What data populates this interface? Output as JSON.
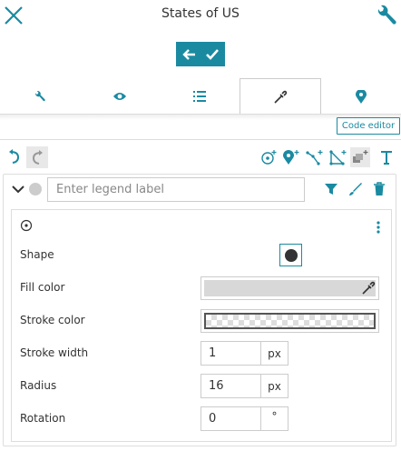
{
  "header": {
    "title": "States of US"
  },
  "tabs": [
    {
      "name": "settings",
      "icon": "wrench-icon"
    },
    {
      "name": "preview",
      "icon": "eye-icon"
    },
    {
      "name": "list",
      "icon": "list-icon"
    },
    {
      "name": "style",
      "icon": "eyedropper-icon",
      "active": true
    },
    {
      "name": "location",
      "icon": "map-marker-icon"
    }
  ],
  "code_editor_label": "Code editor",
  "layer": {
    "legend_placeholder": "Enter legend label",
    "legend_value": ""
  },
  "style": {
    "shape_label": "Shape",
    "fill_color_label": "Fill color",
    "fill_color": "#d8d8d8",
    "stroke_color_label": "Stroke color",
    "stroke_width_label": "Stroke width",
    "stroke_width_value": "1",
    "stroke_width_unit": "px",
    "radius_label": "Radius",
    "radius_value": "16",
    "radius_unit": "px",
    "rotation_label": "Rotation",
    "rotation_value": "0",
    "rotation_unit": "°"
  },
  "colors": {
    "accent": "#1a8aa1"
  }
}
